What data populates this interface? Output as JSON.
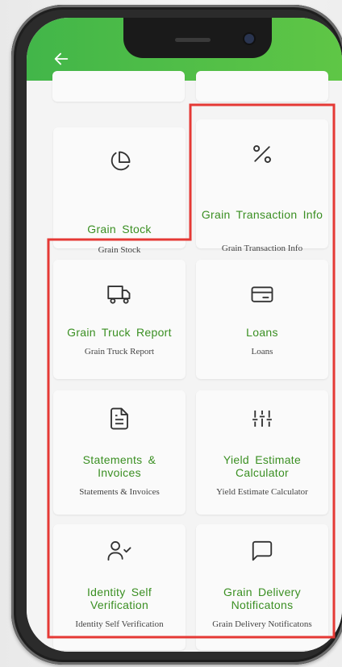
{
  "appbar": {
    "back_icon": "arrow-left-icon",
    "color": "#4cbb47"
  },
  "accent": {
    "title_color": "#3a8f22",
    "highlight_color": "#e53935"
  },
  "cards": [
    {
      "title": "Grain Stock",
      "subtitle": "Grain Stock",
      "icon": "pie-chart-icon"
    },
    {
      "title": "Grain Transaction Info",
      "subtitle": "Grain Transaction Info",
      "icon": "percent-icon"
    },
    {
      "title": "Grain Truck Report",
      "subtitle": "Grain Truck Report",
      "icon": "truck-icon"
    },
    {
      "title": "Loans",
      "subtitle": "Loans",
      "icon": "credit-card-icon"
    },
    {
      "title": "Statements & Invoices",
      "subtitle": "Statements & Invoices",
      "icon": "document-icon"
    },
    {
      "title": "Yield Estimate Calculator",
      "subtitle": "Yield Estimate Calculator",
      "icon": "sliders-icon"
    },
    {
      "title": "Identity Self Verification",
      "subtitle": "Identity Self Verification",
      "icon": "user-check-icon"
    },
    {
      "title": "Grain Delivery Notificatons",
      "subtitle": "Grain Delivery Notificatons",
      "icon": "message-square-icon"
    }
  ]
}
